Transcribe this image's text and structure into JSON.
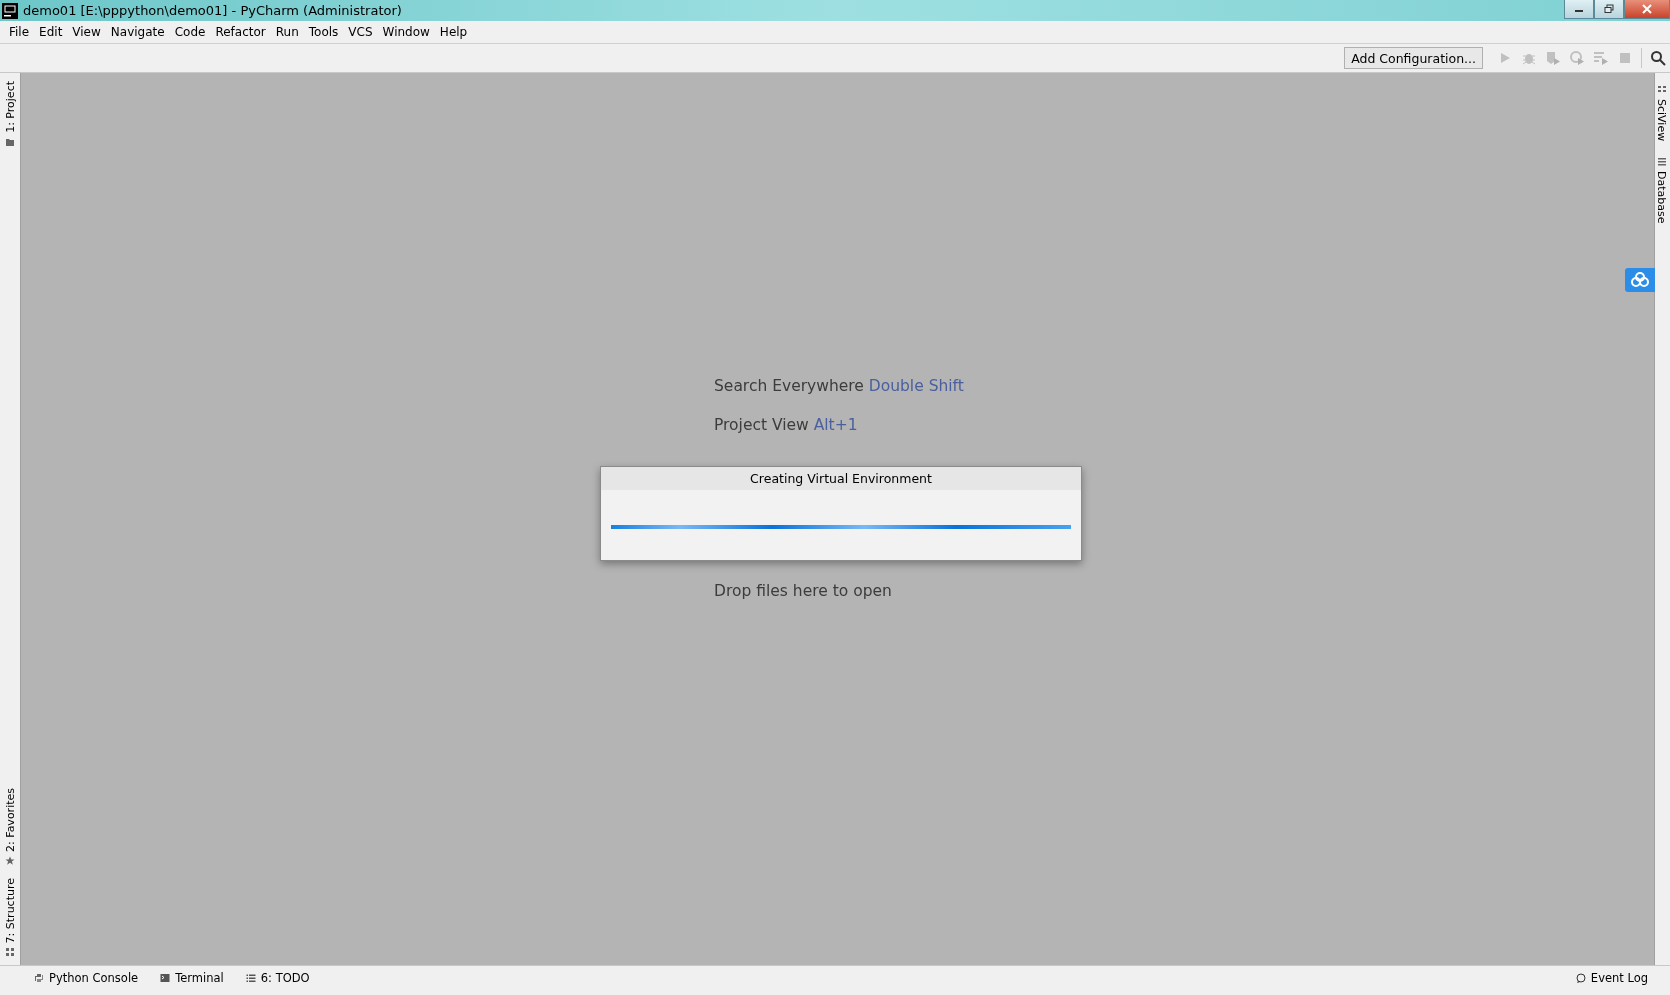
{
  "window": {
    "title": "demo01 [E:\\pppython\\demo01] - PyCharm (Administrator)"
  },
  "menu": [
    "File",
    "Edit",
    "View",
    "Navigate",
    "Code",
    "Refactor",
    "Run",
    "Tools",
    "VCS",
    "Window",
    "Help"
  ],
  "toolbar": {
    "configuration": "Add Configuration..."
  },
  "left_tool_windows": {
    "top": [
      {
        "label": "1: Project",
        "kind": "folder"
      }
    ],
    "bottom": [
      {
        "label": "2: Favorites",
        "kind": "star"
      },
      {
        "label": "7: Structure",
        "kind": "structure"
      }
    ]
  },
  "right_tool_windows": [
    {
      "label": "SciView",
      "kind": "grid"
    },
    {
      "label": "Database",
      "kind": "database"
    }
  ],
  "hints": [
    {
      "text": "Search Everywhere",
      "shortcut": "Double Shift"
    },
    {
      "text": "Project View",
      "shortcut": "Alt+1"
    },
    {
      "text": "Drop files here to open"
    }
  ],
  "dialog": {
    "title": "Creating Virtual Environment",
    "level": 1
  },
  "status_bar": {
    "tabs": [
      {
        "label": "Python Console",
        "kind": "python"
      },
      {
        "label": "Terminal",
        "kind": "terminal"
      },
      {
        "label": "6: TODO",
        "kind": "list"
      }
    ],
    "right": "Event Log"
  }
}
